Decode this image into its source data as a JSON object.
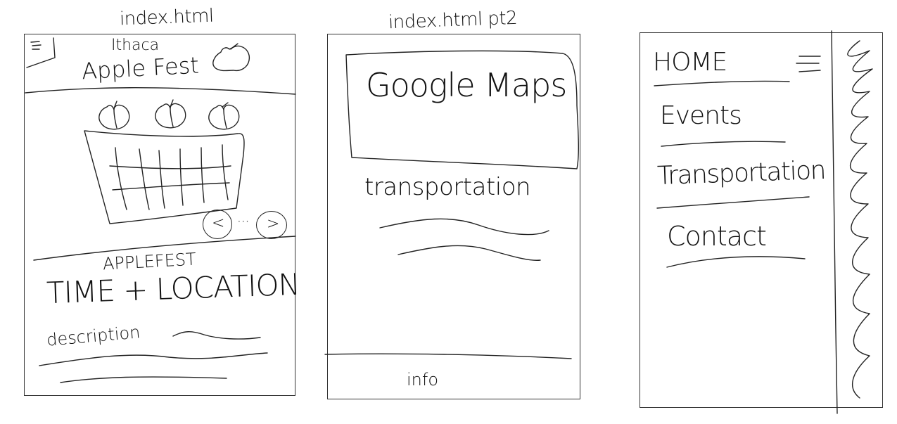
{
  "frames": {
    "home": {
      "title": "index.html"
    },
    "home_pt2": {
      "title": "index.html pt2"
    },
    "menu": {
      "title": ""
    }
  },
  "home": {
    "header": {
      "title_line1": "Ithaca",
      "title_line2": "Apple Fest"
    },
    "section": {
      "eyebrow": "APPLEFEST",
      "heading": "TIME + LOCATION",
      "description_label": "description"
    },
    "carousel": {
      "prev_label": "<",
      "next_label": ">",
      "dots": "···"
    }
  },
  "home_pt2": {
    "map_label": "Google Maps",
    "transport_heading": "transportation",
    "footer_label": "info"
  },
  "menu": {
    "items": [
      {
        "label": "HOME"
      },
      {
        "label": "Events"
      },
      {
        "label": "Transportation"
      },
      {
        "label": "Contact"
      }
    ]
  },
  "icons": {
    "menu": "hamburger-icon",
    "apple": "apple-icon",
    "basket": "basket-icon"
  }
}
